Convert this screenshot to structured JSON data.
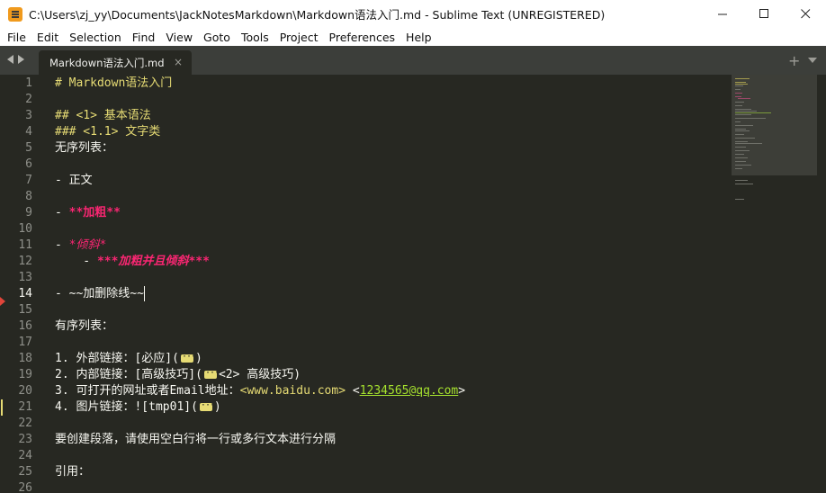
{
  "window": {
    "title": "C:\\Users\\zj_yy\\Documents\\JackNotesMarkdown\\Markdown语法入门.md - Sublime Text (UNREGISTERED)",
    "minimize_glyph": "—",
    "maximize_glyph": "☐",
    "close_glyph": "✕"
  },
  "menu": [
    "File",
    "Edit",
    "Selection",
    "Find",
    "View",
    "Goto",
    "Tools",
    "Project",
    "Preferences",
    "Help"
  ],
  "tabs": {
    "active_tab_label": "Markdown语法入门.md",
    "close_glyph": "×",
    "add_glyph": "+"
  },
  "editor": {
    "active_line": 14,
    "cursor_line": 14,
    "modified_line": 21,
    "line_numbers": [
      "1",
      "2",
      "3",
      "4",
      "5",
      "6",
      "7",
      "8",
      "9",
      "10",
      "11",
      "12",
      "13",
      "14",
      "15",
      "16",
      "17",
      "18",
      "19",
      "20",
      "21",
      "22",
      "23",
      "24",
      "25",
      "26"
    ],
    "lines": {
      "l1": "# Markdown语法入门",
      "l3": "## <1> 基本语法",
      "l4": "### <1.1> 文字类",
      "l5": "无序列表：",
      "l7": "- 正文",
      "l9_prefix": "- ",
      "l9_bold": "**加粗**",
      "l11_prefix": "- ",
      "l11_ital": "*倾斜*",
      "l12_prefix": "    - ",
      "l12_bi": "***加粗并且倾斜***",
      "l14": "- ~~加删除线~~",
      "l16": "有序列表：",
      "l18_a": "1. 外部链接：[必应](",
      "l18_b": ")",
      "l19_a": "2. 内部链接：[高级技巧](",
      "l19_b": "<2> 高级技巧)",
      "l20_a": "3. 可打开的网址或者Email地址：",
      "l20_url": "<www.baidu.com>",
      "l20_sp": " <",
      "l20_email": "1234565@qq.com",
      "l20_end": ">",
      "l21_a": "4. 图片链接：![tmp01](",
      "l21_b": ")",
      "l23": "要创建段落，请使用空白行将一行或多行文本进行分隔",
      "l25": "引用："
    }
  },
  "colors": {
    "editor_bg": "#272822",
    "tabbar_bg": "#3c3e3a",
    "heading_yellow": "#e6db74",
    "emphasis_pink": "#f92672",
    "link_green": "#a6e22e",
    "line_number_gray": "#8f908a"
  }
}
